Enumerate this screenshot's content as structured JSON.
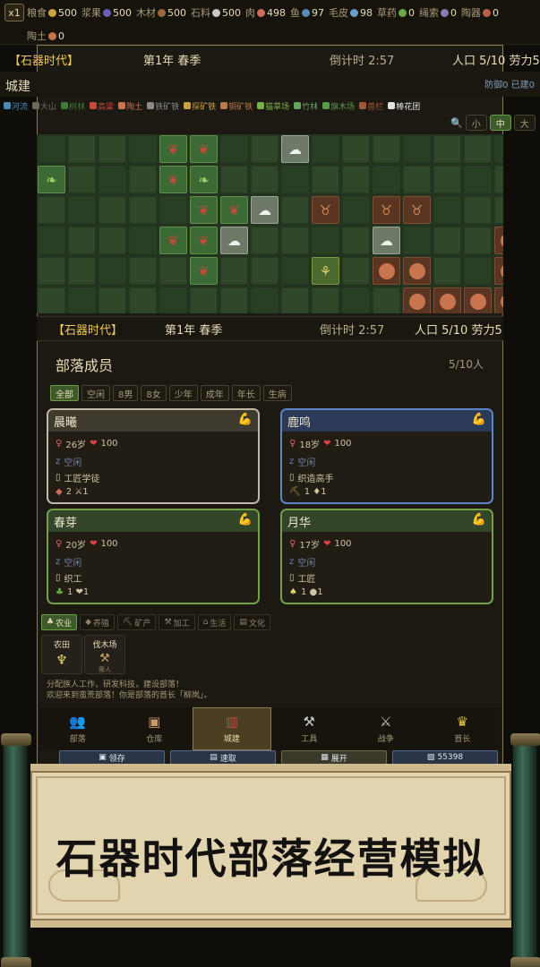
{
  "speed": "x1",
  "resources": [
    {
      "name": "粮食",
      "value": "500",
      "icon": "wheat-icon",
      "color": "#c9a640"
    },
    {
      "name": "浆果",
      "value": "500",
      "icon": "berry-icon",
      "color": "#6a5fb8"
    },
    {
      "name": "木材",
      "value": "500",
      "icon": "log-icon",
      "color": "#9a6a3a"
    },
    {
      "name": "石料",
      "value": "500",
      "icon": "stone-icon",
      "color": "#c8c8c8"
    },
    {
      "name": "肉",
      "value": "498",
      "icon": "meat-icon",
      "color": "#d06a5a"
    },
    {
      "name": "鱼",
      "value": "97",
      "icon": "fish-icon",
      "color": "#5a8ab8"
    },
    {
      "name": "毛皮",
      "value": "98",
      "icon": "fur-icon",
      "color": "#6aa0c8"
    },
    {
      "name": "草药",
      "value": "0",
      "icon": "herb-icon",
      "color": "#6aaa4a"
    },
    {
      "name": "绳索",
      "value": "0",
      "icon": "rope-icon",
      "color": "#8a7ab8"
    },
    {
      "name": "陶器",
      "value": "0",
      "icon": "pot-icon",
      "color": "#b8604a"
    },
    {
      "name": "陶土",
      "value": "0",
      "icon": "clay-icon",
      "color": "#c8744e"
    }
  ],
  "header": {
    "era": "【石器时代】",
    "season": "第1年 春季",
    "timer": "倒计时 2:57",
    "population": "人口 5/10 劳力5"
  },
  "city": {
    "title": "城建",
    "info": "防御0 已建0"
  },
  "legend": [
    {
      "label": "河流",
      "color": "#4a8ab8"
    },
    {
      "label": "大山",
      "color": "#6a6a5a"
    },
    {
      "label": "树林",
      "color": "#3f7a3a"
    },
    {
      "label": "高粱",
      "color": "#c24a3a"
    },
    {
      "label": "陶土",
      "color": "#c8744e"
    },
    {
      "label": "铁矿铁",
      "color": "#8a8a8a"
    },
    {
      "label": "探矿铁",
      "color": "#c8a040"
    },
    {
      "label": "铜矿铁",
      "color": "#b87a4a"
    },
    {
      "label": "猫草场",
      "color": "#7ab04a"
    },
    {
      "label": "竹林",
      "color": "#6aa060"
    },
    {
      "label": "旗木场",
      "color": "#5a9a4a"
    },
    {
      "label": "兽栏",
      "color": "#a05a3a"
    },
    {
      "label": "棒花团",
      "color": "#e0e0e0"
    }
  ],
  "zoom": {
    "small": "小",
    "medium": "中",
    "large": "大"
  },
  "members": {
    "title": "部落成员",
    "count": "5/10人"
  },
  "filters": [
    "全部",
    "空闲",
    "8男",
    "8女",
    "少年",
    "成年",
    "年长",
    "生病"
  ],
  "cards": [
    {
      "name": "晨曦",
      "age": "26岁",
      "hp": "100",
      "status": "空闲",
      "job": "工匠学徒",
      "stats": "2 ⚔1"
    },
    {
      "name": "鹿鸣",
      "age": "18岁",
      "hp": "100",
      "status": "空闲",
      "job": "织造高手",
      "stats": "1 ♦1"
    },
    {
      "name": "春芽",
      "age": "20岁",
      "hp": "100",
      "status": "空闲",
      "job": "织工",
      "stats": "1 ❤1"
    },
    {
      "name": "月华",
      "age": "17岁",
      "hp": "100",
      "status": "空闲",
      "job": "工匠",
      "stats": "1 ●1"
    }
  ],
  "build_filters": [
    "农业",
    "养殖",
    "矿产",
    "加工",
    "生活",
    "文化"
  ],
  "buildings": [
    {
      "title": "农田",
      "sub": ""
    },
    {
      "title": "伐木场",
      "sub": "需人"
    }
  ],
  "log": [
    "分配族人工作，研发科技，建设部落！",
    "欢迎来到蛮荒部落！你是部落的首长「柳岚」。"
  ],
  "nav": [
    "部落",
    "仓库",
    "城建",
    "工具",
    "战争",
    "首长"
  ],
  "nav_active": 2,
  "sub_strip": [
    "领存",
    "速取",
    "展开",
    "55398"
  ],
  "banner_title": "石器时代部落经营模拟"
}
